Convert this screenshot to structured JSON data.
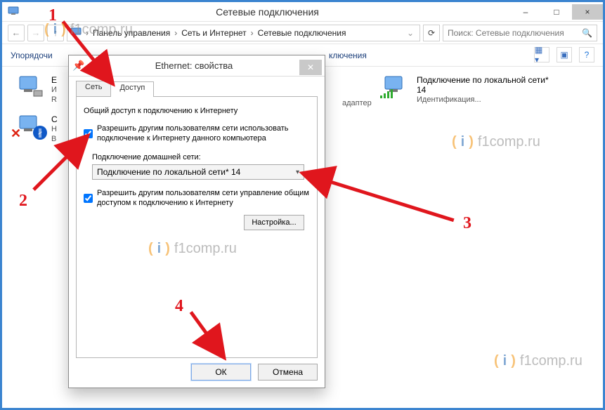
{
  "window": {
    "title": "Сетевые подключения",
    "minimize": "–",
    "maximize": "□",
    "close": "×"
  },
  "breadcrumb": {
    "items": [
      "Панель управления",
      "Сеть и Интернет",
      "Сетевые подключения"
    ],
    "sep": "›"
  },
  "search": {
    "placeholder": "Поиск: Сетевые подключения"
  },
  "toolbar": {
    "organize": "Упорядочи"
  },
  "adapters": {
    "right_truncated_hint": "ключения",
    "adapter_hint": "адаптер",
    "a0": {
      "name": "E",
      "sub": "И",
      "sub2": "R"
    },
    "a1": {
      "name": "С",
      "sub": "Н",
      "sub2": "B"
    },
    "a2": {
      "name": "Подключение по локальной сети* 14",
      "sub": "Идентификация..."
    }
  },
  "dialog": {
    "title": "Ethernet: свойства",
    "tab_network": "Сеть",
    "tab_sharing": "Доступ",
    "group": "Общий доступ к подключению к Интернету",
    "cb1": "Разрешить другим пользователям сети использовать подключение к Интернету данного компьютера",
    "homenet_label": "Подключение домашней сети:",
    "combo_value": "Подключение по локальной сети* 14",
    "cb2": "Разрешить другим пользователям сети управление общим доступом к подключению к Интернету",
    "settings_btn": "Настройка...",
    "ok": "ОК",
    "cancel": "Отмена"
  },
  "annotations": {
    "n1": "1",
    "n2": "2",
    "n3": "3",
    "n4": "4"
  },
  "watermark": "f1comp.ru"
}
